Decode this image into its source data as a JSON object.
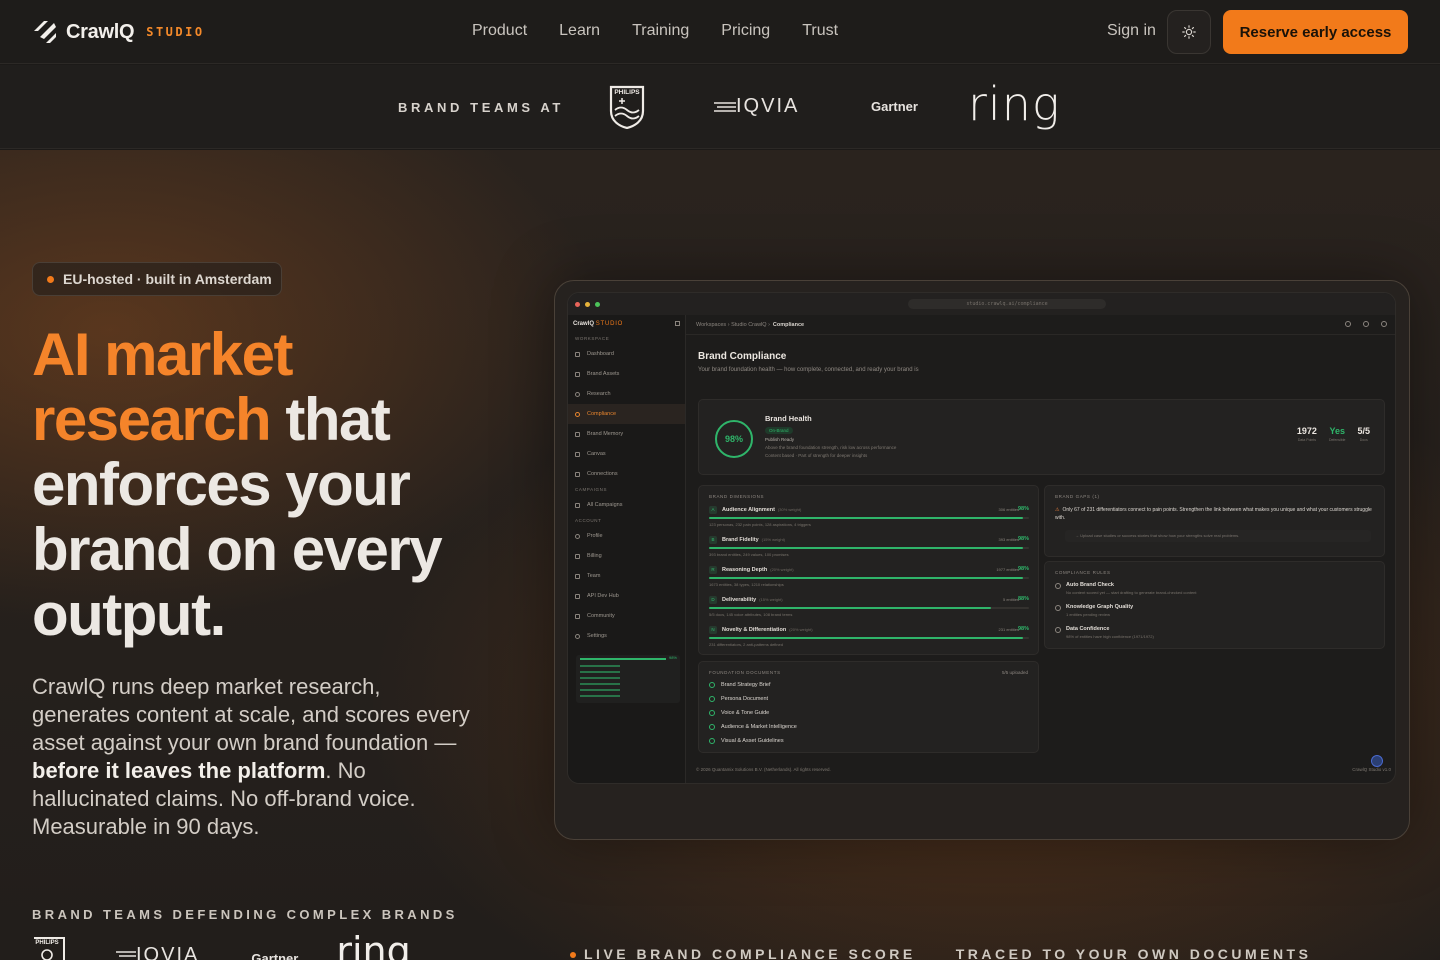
{
  "nav": {
    "brand": "CrawlQ",
    "brand_sub": "STUDIO",
    "links": [
      "Product",
      "Learn",
      "Training",
      "Pricing",
      "Trust"
    ],
    "sign_in": "Sign in",
    "theme_icon": "sun-icon",
    "cta": "Reserve early access"
  },
  "brandbar": {
    "label": "BRAND TEAMS AT",
    "logos": [
      "PHILIPS",
      "IQVIA",
      "Gartner",
      "ring"
    ]
  },
  "hero": {
    "pill": "EU-hosted · built in Amsterdam",
    "headline_accent": "AI market research",
    "headline_rest": " that enforces your brand on every output.",
    "lede_1": "CrawlQ runs deep market research, generates content at scale, and scores every asset against your own brand foundation — ",
    "lede_bold": "before it leaves the platform",
    "lede_2": ". No hallucinated claims. No off-brand voice. Measurable in 90 days.",
    "defending": "BRAND TEAMS DEFENDING COMPLEX BRANDS",
    "bottom_1": "LIVE BRAND COMPLIANCE SCORE",
    "bottom_2": "TRACED TO YOUR OWN DOCUMENTS"
  },
  "app": {
    "url": "studio.crawlq.ai/compliance",
    "sidebar_brand": "CrawlQ",
    "sidebar_brand_sub": "STUDIO",
    "sections": {
      "workspace": "WORKSPACE",
      "campaigns": "CAMPAIGNS",
      "account": "ACCOUNT"
    },
    "workspace_items": [
      "Dashboard",
      "Brand Assets",
      "Research",
      "Compliance",
      "Brand Memory",
      "Canvas",
      "Connections"
    ],
    "campaign_items": [
      "All Campaigns"
    ],
    "account_items": [
      "Profile",
      "Billing",
      "Team",
      "API Dev Hub",
      "Community",
      "Settings"
    ],
    "crumbs": [
      "Workspaces",
      "›",
      "Studio CrawlQ",
      "›"
    ],
    "crumb_current": "Compliance",
    "title": "Brand Compliance",
    "subtitle": "Your brand foundation health — how complete, connected, and ready your brand is",
    "health": {
      "score": "98%",
      "title": "Brand Health",
      "badge": "On-Brand",
      "line1": "Publish Ready",
      "line2": "Above the brand foundation strength, risk low across performance",
      "line3": "Content based · Part of strength for deeper insights",
      "stats": [
        {
          "value": "1972",
          "label": "Data Points"
        },
        {
          "value": "Yes",
          "label": "Defensible"
        },
        {
          "value": "5/5",
          "label": "Docs"
        }
      ]
    },
    "dimensions_label": "BRAND DIMENSIONS",
    "dimensions": [
      {
        "tag": "A",
        "name": "Audience Alignment",
        "weight": "(30% weight)",
        "entities": "306 entities",
        "pct": "98%",
        "score": 0.98,
        "meta": "123 personas, 232 pain points, 128 aspirations, 4 triggers"
      },
      {
        "tag": "B",
        "name": "Brand Fidelity",
        "weight": "(15% weight)",
        "entities": "393 entities",
        "pct": "98%",
        "score": 0.98,
        "meta": "393 brand entities, 249 values, 100 promises"
      },
      {
        "tag": "R",
        "name": "Reasoning Depth",
        "weight": "(20% weight)",
        "entities": "1977 entities",
        "pct": "98%",
        "score": 0.98,
        "meta": "1673 entities, 38 types, 1210 relationships"
      },
      {
        "tag": "D",
        "name": "Deliverability",
        "weight": "(15% weight)",
        "entities": "5 entities",
        "pct": "88%",
        "score": 0.88,
        "meta": "5/5 docs, 145 voice attributes, 108 brand terms"
      },
      {
        "tag": "N",
        "name": "Novelty & Differentiation",
        "weight": "(20% weight)",
        "entities": "231 entities",
        "pct": "98%",
        "score": 0.98,
        "meta": "231 differentiators, 2 anti-patterns defined"
      }
    ],
    "gaps_label": "BRAND GAPS (1)",
    "gap_text": "Only 67 of 231 differentiators connect to pain points. Strengthen the link between what makes you unique and what your customers struggle with.",
    "gap_sub": "→ Upload case studies or success stories that show how your strengths solve real problems.",
    "rules_label": "COMPLIANCE RULES",
    "rules": [
      {
        "title": "Auto Brand Check",
        "desc": "No content scored yet — start drafting to generate brand-checked content"
      },
      {
        "title": "Knowledge Graph Quality",
        "desc": "1 entities pending review"
      },
      {
        "title": "Data Confidence",
        "desc": "98% of entities have high confidence (1971/1972)"
      }
    ],
    "docs_label": "FOUNDATION DOCUMENTS",
    "docs_count": "5/5 uploaded",
    "docs": [
      "Brand Strategy Brief",
      "Persona Document",
      "Voice & Tone Guide",
      "Audience & Market Intelligence",
      "Visual & Asset Guidelines"
    ],
    "side_stats_value": "98%",
    "footer": "© 2026 Quantamix Solutions B.V. (Netherlands). All rights reserved.",
    "footer_version": "CrawlQ Studio v1.0"
  },
  "colors": {
    "accent": "#f27a1a",
    "success": "#2fb56a",
    "bg": "#1c1a18"
  }
}
